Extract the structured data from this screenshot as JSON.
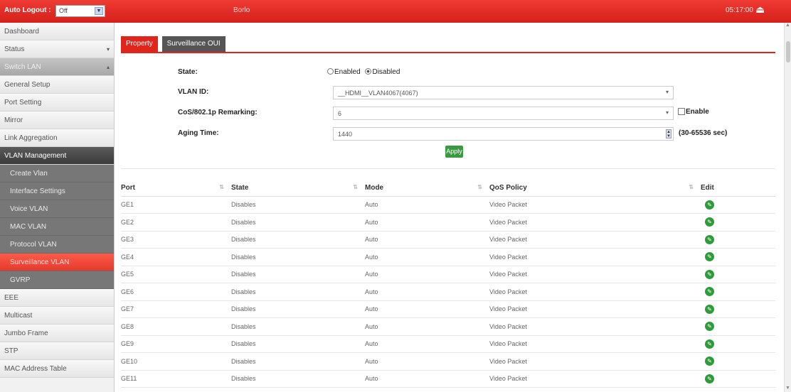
{
  "topbar": {
    "auto_logout_label": "Auto Logout :",
    "auto_logout_value": "Off",
    "hostname": "Borlo",
    "clock": "05:17:00"
  },
  "sidebar": {
    "items": [
      {
        "label": "Dashboard"
      },
      {
        "label": "Status"
      },
      {
        "label": "Switch LAN"
      },
      {
        "label": "General Setup"
      },
      {
        "label": "Port Setting"
      },
      {
        "label": "Mirror"
      },
      {
        "label": "Link Aggregation"
      },
      {
        "label": "VLAN Management"
      },
      {
        "label": "Create Vlan"
      },
      {
        "label": "Interface Settings"
      },
      {
        "label": "Voice VLAN"
      },
      {
        "label": "MAC VLAN"
      },
      {
        "label": "Protocol VLAN"
      },
      {
        "label": "Surveillance VLAN"
      },
      {
        "label": "GVRP"
      },
      {
        "label": "EEE"
      },
      {
        "label": "Multicast"
      },
      {
        "label": "Jumbo Frame"
      },
      {
        "label": "STP"
      },
      {
        "label": "MAC Address Table"
      }
    ]
  },
  "tabs": [
    {
      "label": "Property"
    },
    {
      "label": "Surveillance OUI"
    }
  ],
  "form": {
    "state_label": "State:",
    "state_enabled": "Enabled",
    "state_disabled": "Disabled",
    "vlan_id_label": "VLAN ID:",
    "vlan_id_value": "__HDMI__VLAN4067(4067)",
    "cos_label": "CoS/802.1p Remarking:",
    "cos_value": "6",
    "cos_enable": "Enable",
    "aging_label": "Aging Time:",
    "aging_value": "1440",
    "aging_range": "(30-65536 sec)",
    "apply_label": "Apply"
  },
  "table": {
    "headers": [
      "Port",
      "State",
      "Mode",
      "QoS Policy",
      "Edit"
    ],
    "rows": [
      {
        "port": "GE1",
        "state": "Disables",
        "mode": "Auto",
        "qos": "Video Packet"
      },
      {
        "port": "GE2",
        "state": "Disables",
        "mode": "Auto",
        "qos": "Video Packet"
      },
      {
        "port": "GE3",
        "state": "Disables",
        "mode": "Auto",
        "qos": "Video Packet"
      },
      {
        "port": "GE4",
        "state": "Disables",
        "mode": "Auto",
        "qos": "Video Packet"
      },
      {
        "port": "GE5",
        "state": "Disables",
        "mode": "Auto",
        "qos": "Video Packet"
      },
      {
        "port": "GE6",
        "state": "Disables",
        "mode": "Auto",
        "qos": "Video Packet"
      },
      {
        "port": "GE7",
        "state": "Disables",
        "mode": "Auto",
        "qos": "Video Packet"
      },
      {
        "port": "GE8",
        "state": "Disables",
        "mode": "Auto",
        "qos": "Video Packet"
      },
      {
        "port": "GE9",
        "state": "Disables",
        "mode": "Auto",
        "qos": "Video Packet"
      },
      {
        "port": "GE10",
        "state": "Disables",
        "mode": "Auto",
        "qos": "Video Packet"
      },
      {
        "port": "GE11",
        "state": "Disables",
        "mode": "Auto",
        "qos": "Video Packet"
      }
    ]
  },
  "colors": {
    "accent": "#e0251c",
    "apply": "#3a9a3f",
    "active_nav": "#ff5a4a"
  },
  "icons": {
    "logout": "logout-icon",
    "edit": "edit-wrench-icon"
  }
}
